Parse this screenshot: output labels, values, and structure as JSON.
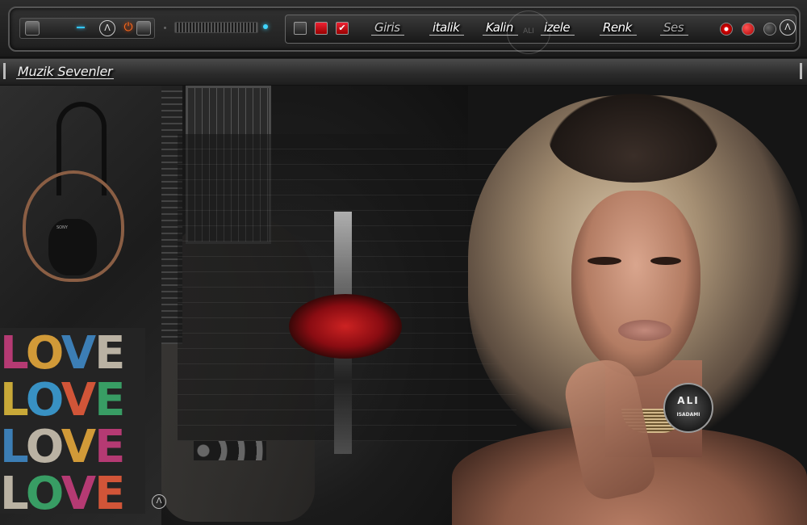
{
  "toolbar": {
    "menu": {
      "giris": "Giris",
      "italik": "italik",
      "kalin": "Kalin",
      "izele": "izele",
      "renk": "Renk",
      "ses": "Ses"
    },
    "watermark": "ALI",
    "accent": "#ff6a1a",
    "led": "#3fd6ff"
  },
  "title": {
    "text": "Muzik Sevenler"
  },
  "art": {
    "love_word": "LOVE",
    "love_colors": [
      [
        "#c23c7a",
        "#e0a43a",
        "#3f86c2",
        "#c7bfae"
      ],
      [
        "#d6b43a",
        "#3a9bd1",
        "#e05a3a",
        "#3aa86a"
      ],
      [
        "#3f86c2",
        "#c7bfae",
        "#e0a43a",
        "#c23c7a"
      ],
      [
        "#c7bfae",
        "#3aa86a",
        "#c23c7a",
        "#e05a3a"
      ]
    ],
    "badge_main": "ALI",
    "badge_sub": "ISADAMI",
    "sony": "SONY"
  }
}
